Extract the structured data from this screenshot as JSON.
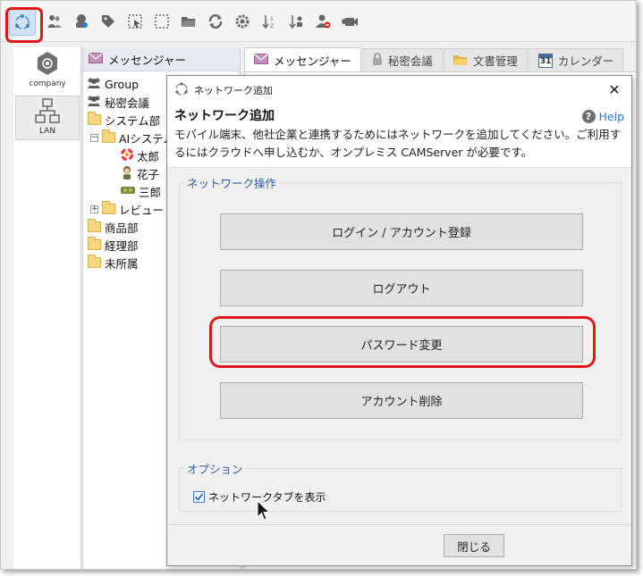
{
  "toolbar": {
    "icons": [
      "network-add-icon",
      "users-icon",
      "user-settings-icon",
      "tag-icon",
      "select-icon",
      "marquee-icon",
      "folder-open-icon",
      "sync-icon",
      "gear-icon",
      "sort-icon",
      "sort-down-icon",
      "user-remove-icon",
      "video-icon"
    ]
  },
  "networks": [
    {
      "label": "company",
      "icon": "company-icon"
    },
    {
      "label": "LAN",
      "icon": "lan-icon"
    }
  ],
  "tree": {
    "header": "メッセンジャー",
    "items": [
      {
        "label": "Group",
        "icon": "group-icon"
      },
      {
        "label": "秘密会議",
        "icon": "group-icon"
      },
      {
        "label": "システム部",
        "icon": "folder-icon"
      },
      {
        "label": "AIシステム",
        "icon": "folder-icon"
      },
      {
        "label": "太郎",
        "icon": "user-icon"
      },
      {
        "label": "花子",
        "icon": "user-icon"
      },
      {
        "label": "三郎",
        "icon": "user-icon"
      },
      {
        "label": "レビュー",
        "icon": "folder-icon"
      },
      {
        "label": "商品部",
        "icon": "folder-icon"
      },
      {
        "label": "経理部",
        "icon": "folder-icon"
      },
      {
        "label": "未所属",
        "icon": "folder-icon"
      }
    ]
  },
  "tabs": [
    {
      "label": "メッセンジャー",
      "icon": "mail-icon",
      "active": true
    },
    {
      "label": "秘密会議",
      "icon": "lock-icon",
      "active": false
    },
    {
      "label": "文書管理",
      "icon": "folder-icon",
      "active": false
    },
    {
      "label": "カレンダー",
      "icon": "calendar-icon",
      "active": false
    }
  ],
  "calendar_day": "31",
  "dialog": {
    "window_title": "ネットワーク追加",
    "heading": "ネットワーク追加",
    "help": "Help",
    "description": "モバイル端末、他社企業と連携するためにはネットワークを追加してください。ご利用するにはクラウドへ申し込むか、オンプレミス CAMServer が必要です。",
    "network_ops": {
      "title": "ネットワーク操作",
      "buttons": [
        "ログイン / アカウント登録",
        "ログアウト",
        "パスワード変更",
        "アカウント削除"
      ]
    },
    "options": {
      "title": "オプション",
      "show_network_tab": {
        "label": "ネットワークタブを表示",
        "checked": true
      }
    },
    "close_button": "閉じる"
  },
  "colors": {
    "highlight": "#e01818",
    "accent": "#2c5ea8",
    "link": "#2a7bd5"
  }
}
